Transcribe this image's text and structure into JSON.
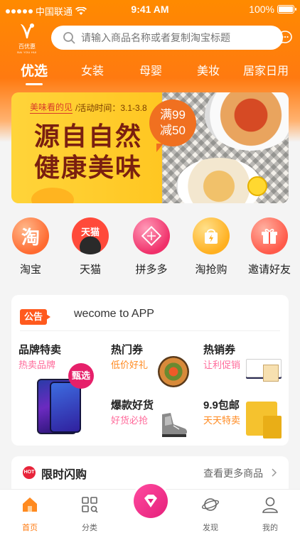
{
  "status_bar": {
    "carrier": "中国联通",
    "time": "9:41 AM",
    "battery": "100%"
  },
  "header": {
    "logo_text": "百优惠",
    "logo_sub": "BAI YOU HUI",
    "search_placeholder": "请输入商品名称或者复制淘宝标题"
  },
  "tabs": [
    {
      "label": "优选",
      "active": true
    },
    {
      "label": "女装",
      "active": false
    },
    {
      "label": "母婴",
      "active": false
    },
    {
      "label": "美妆",
      "active": false
    },
    {
      "label": "居家日用",
      "active": false
    }
  ],
  "banner": {
    "tag": "美味看的见",
    "activity_time": "/活动时间：3.1-3.8",
    "title_line1": "源自自然",
    "title_line2": "健康美味",
    "badge_line1": "满99",
    "badge_line2": "减50"
  },
  "shortcuts": [
    {
      "label": "淘宝",
      "icon": "taobao-icon",
      "glyph": "淘",
      "color": "#ff6a30"
    },
    {
      "label": "天猫",
      "icon": "tmall-icon",
      "glyph": "天猫",
      "color": "#ff4a3a"
    },
    {
      "label": "拼多多",
      "icon": "pinduoduo-icon",
      "glyph": "",
      "color": "#f0306a"
    },
    {
      "label": "淘抢购",
      "icon": "taoqianggou-icon",
      "glyph": "",
      "color": "#ffb020"
    },
    {
      "label": "邀请好友",
      "icon": "invite-gift-icon",
      "glyph": "",
      "color": "#ff5a4a"
    }
  ],
  "notice": {
    "tag": "公告",
    "text": "wecome to APP"
  },
  "promos": {
    "brand": {
      "title": "品牌特卖",
      "sub": "热卖品牌",
      "badge": "甄选"
    },
    "hot_coupon": {
      "title": "热门券",
      "sub": "低价好礼"
    },
    "bestseller_coupon": {
      "title": "热销券",
      "sub": "让利促销"
    },
    "hot_goods": {
      "title": "爆款好货",
      "sub": "好货必抢"
    },
    "free_shipping": {
      "title": "9.9包邮",
      "sub": "天天特卖"
    }
  },
  "flash_sale": {
    "icon_text": "HOT",
    "title": "限时闪购",
    "more": "查看更多商品"
  },
  "tabbar": [
    {
      "label": "首页",
      "active": true
    },
    {
      "label": "分类",
      "active": false
    },
    {
      "label": "发现",
      "active": false
    },
    {
      "label": "我的",
      "active": false
    }
  ],
  "colors": {
    "brand": "#ff7a10",
    "accent_pink": "#e5207a",
    "sub_pink": "#ff6a9a",
    "sub_orange": "#ff8a20"
  }
}
